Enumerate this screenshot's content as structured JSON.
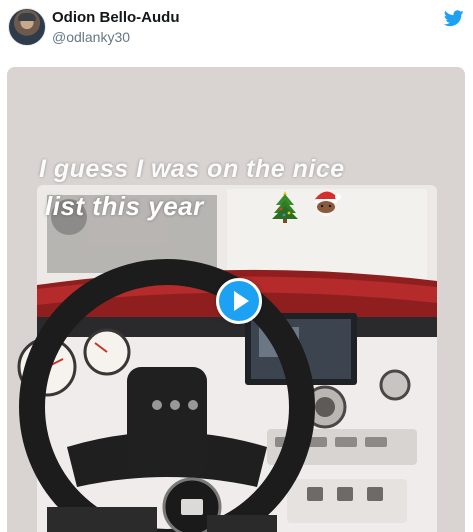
{
  "tweet": {
    "author": {
      "display_name": "Odion Bello-Audu",
      "handle": "@odlanky30",
      "avatar_icon": "user-avatar"
    },
    "brand_icon": "twitter-bird-icon",
    "brand_color": "#1da1f2",
    "media": {
      "type": "video",
      "caption_line1": "I guess I was on the nice",
      "caption_line2": "list this year",
      "emojis": [
        "christmas-tree-emoji",
        "santa-emoji"
      ],
      "play_icon": "play-icon"
    }
  }
}
